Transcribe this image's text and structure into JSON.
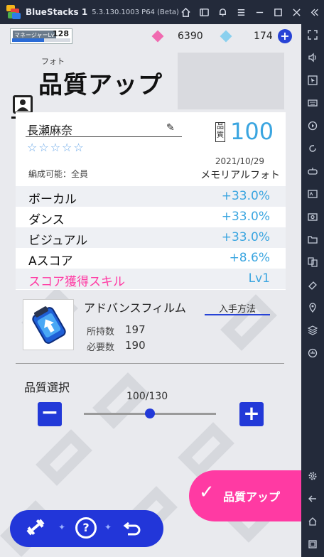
{
  "emulator": {
    "app_name": "BlueStacks 1",
    "version": "5.3.130.1003 P64 (Beta)",
    "title_icons": [
      "home-icon",
      "library-icon",
      "bell-icon",
      "settings-icon",
      "minimize-icon",
      "maximize-icon",
      "close-icon",
      "collapse-icon"
    ],
    "sidebar_icons": [
      "fullscreen-icon",
      "volume-icon",
      "pointer-icon",
      "keyboard-icon",
      "record-icon",
      "rotate-icon",
      "controller-icon",
      "apk-icon",
      "screenshot-icon",
      "folder-icon",
      "multi-instance-icon",
      "eraser-icon",
      "location-icon",
      "layers-icon",
      "macro-icon",
      "gear-icon",
      "back-icon",
      "home-icon",
      "recent-icon"
    ]
  },
  "header": {
    "manager_label": "マネージャーLv",
    "manager_level": "128",
    "manager_progress": 0.55,
    "gem_free": "6390",
    "gem_paid": "174",
    "add_gem": "+"
  },
  "title": {
    "ruby": "フォト",
    "text": "品質アップ"
  },
  "photo": {
    "name": "長瀬麻奈",
    "stars": [
      "☆",
      "☆",
      "☆",
      "☆",
      "☆"
    ],
    "quality_label": "品質",
    "quality_value": "100",
    "date": "2021/10/29",
    "formation": "編成可能：全員",
    "type": "メモリアルフォト"
  },
  "stats": [
    {
      "label": "ボーカル",
      "value": "+33.0%"
    },
    {
      "label": "ダンス",
      "value": "+33.0%"
    },
    {
      "label": "ビジュアル",
      "value": "+33.0%"
    },
    {
      "label": "Aスコア",
      "value": "+8.6%"
    },
    {
      "label": "スコア獲得スキル",
      "value": "Lv1"
    }
  ],
  "material": {
    "name": "アドバンスフィルム",
    "get_link": "入手方法",
    "owned_label": "所持数",
    "owned_value": "197",
    "required_label": "必要数",
    "required_value": "190"
  },
  "quality_select": {
    "title": "品質選択",
    "count": "100/130",
    "current": 100,
    "max": 130,
    "minus": "−",
    "plus": "+"
  },
  "actions": {
    "upgrade": "品質アップ",
    "help": "?"
  },
  "colors": {
    "accent_blue": "#2239d8",
    "stat_blue": "#3aa5e0",
    "skill_pink": "#ff3aa3",
    "upgrade_pink": "#ff3aa3"
  }
}
